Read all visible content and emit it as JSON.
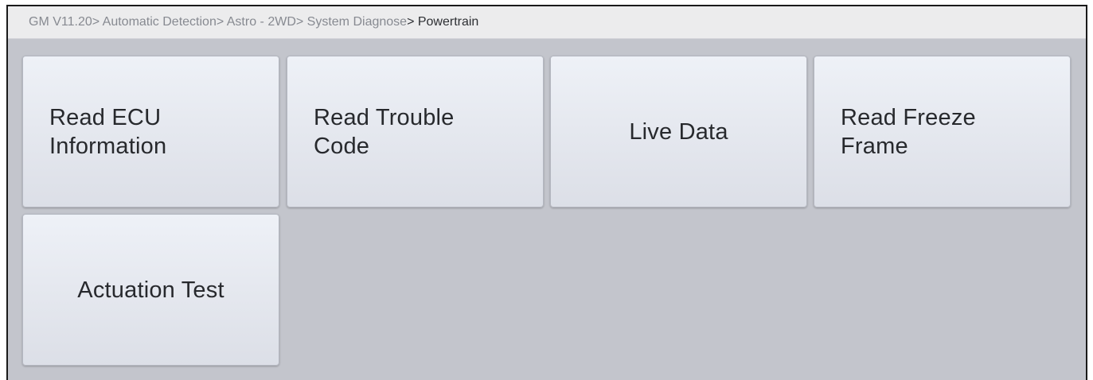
{
  "breadcrumb": {
    "items": [
      "GM V11.20",
      "> Automatic Detection",
      "> Astro - 2WD",
      "> System Diagnose",
      "> Powertrain"
    ]
  },
  "menu": {
    "tiles": [
      {
        "line1": "Read ECU",
        "line2": "Information"
      },
      {
        "line1": "Read Trouble",
        "line2": "Code"
      },
      {
        "line1": "Live Data",
        "line2": ""
      },
      {
        "line1": "Read Freeze",
        "line2": "Frame"
      },
      {
        "line1": "Actuation Test",
        "line2": ""
      }
    ]
  },
  "colors": {
    "background": "#c3c5cc",
    "tile": "#e6e9ef",
    "breadcrumb_bar": "#ececed"
  }
}
